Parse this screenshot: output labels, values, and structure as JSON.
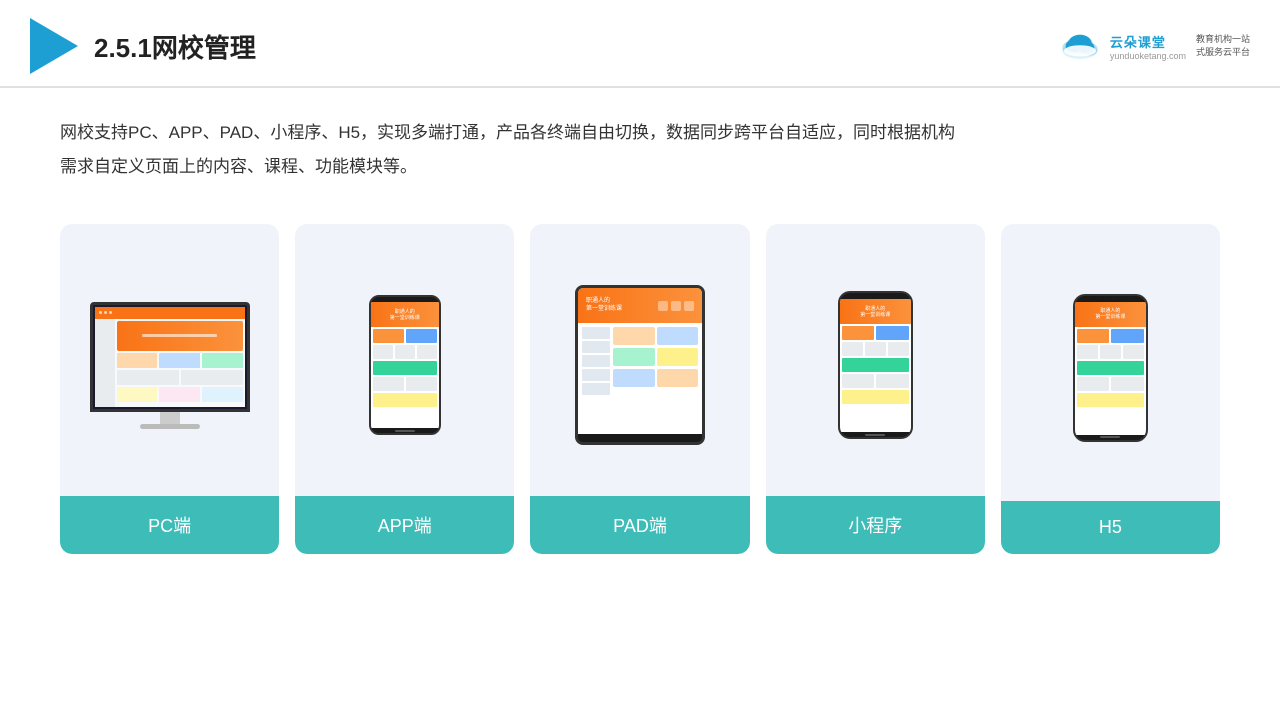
{
  "header": {
    "title": "2.5.1网校管理",
    "brand": {
      "name": "云朵课堂",
      "url": "yunduoketang.com",
      "tagline": "教育机构一站\n式服务云平台"
    }
  },
  "description": {
    "line1": "网校支持PC、APP、PAD、小程序、H5，实现多端打通，产品各终端自由切换，数据同步跨平台自适应，同时根据机构",
    "line2": "需求自定义页面上的内容、课程、功能模块等。"
  },
  "cards": [
    {
      "id": "pc",
      "label": "PC端"
    },
    {
      "id": "app",
      "label": "APP端"
    },
    {
      "id": "pad",
      "label": "PAD端"
    },
    {
      "id": "miniapp",
      "label": "小程序"
    },
    {
      "id": "h5",
      "label": "H5"
    }
  ],
  "colors": {
    "accent": "#3dbcb8",
    "header_line": "#e0e0e0",
    "card_bg": "#f0f4fa",
    "title": "#222222",
    "brand_color": "#1e9fd4"
  }
}
